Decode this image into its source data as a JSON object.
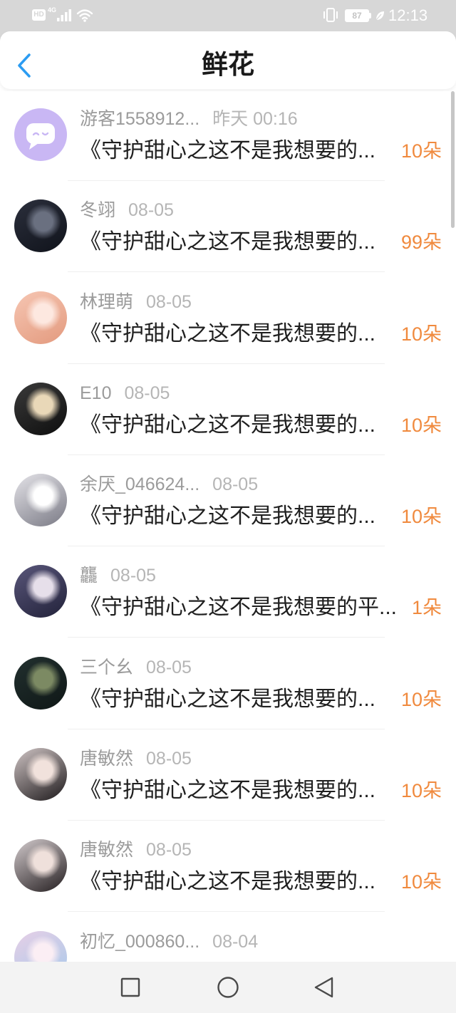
{
  "status_bar": {
    "hd_label": "HD",
    "network_label": "4G",
    "battery_level": "87",
    "time": "12:13",
    "icons": [
      "signal-icon",
      "wifi-icon",
      "vibrate-icon",
      "battery-icon",
      "eco-leaf-icon"
    ]
  },
  "header": {
    "back_icon": "chevron-left-icon",
    "title": "鲜花"
  },
  "flower_records": [
    {
      "user": "游客1558912...",
      "time": "昨天 00:16",
      "book": "《守护甜心之这不是我想要的...",
      "amount": "10朵",
      "avatar": {
        "icon": "chat-bubble-icon",
        "colors": [
          "#c9b7f4"
        ]
      }
    },
    {
      "user": "冬翊",
      "time": "08-05",
      "book": "《守护甜心之这不是我想要的...",
      "amount": "99朵",
      "avatar": {
        "colors": [
          "#6a7080",
          "#2b2f3c",
          "#10131b"
        ]
      }
    },
    {
      "user": "林理萌",
      "time": "08-05",
      "book": "《守护甜心之这不是我想要的...",
      "amount": "10朵",
      "avatar": {
        "colors": [
          "#fde8e0",
          "#f6c6b3",
          "#e39a7e"
        ]
      }
    },
    {
      "user": "E10",
      "time": "08-05",
      "book": "《守护甜心之这不是我想要的...",
      "amount": "10朵",
      "avatar": {
        "colors": [
          "#e9d8b8",
          "#3a3a3a",
          "#0e0e0e"
        ]
      }
    },
    {
      "user": "余厌_046624...",
      "time": "08-05",
      "book": "《守护甜心之这不是我想要的...",
      "amount": "10朵",
      "avatar": {
        "colors": [
          "#ffffff",
          "#e4e3e8",
          "#7a7a85"
        ]
      }
    },
    {
      "user": "龘",
      "time": "08-05",
      "book": "《守护甜心之这不是我想要的平...",
      "amount": "1朵",
      "avatar": {
        "colors": [
          "#e6dfea",
          "#59567a",
          "#22223a"
        ]
      }
    },
    {
      "user": "三个幺",
      "time": "08-05",
      "book": "《守护甜心之这不是我想要的...",
      "amount": "10朵",
      "avatar": {
        "colors": [
          "#7c8a63",
          "#22302f",
          "#0f1716"
        ]
      }
    },
    {
      "user": "唐敏然",
      "time": "08-05",
      "book": "《守护甜心之这不是我想要的...",
      "amount": "10朵",
      "avatar": {
        "colors": [
          "#f1e2dc",
          "#cfc4c4",
          "#1e1a1c"
        ]
      }
    },
    {
      "user": "唐敏然",
      "time": "08-05",
      "book": "《守护甜心之这不是我想要的...",
      "amount": "10朵",
      "avatar": {
        "colors": [
          "#efe0db",
          "#d3cbcd",
          "#241e20"
        ]
      }
    },
    {
      "user": "初忆_000860...",
      "time": "08-04",
      "avatar": {
        "colors": [
          "#fbeef4",
          "#e7cfe6",
          "#a6c9ea"
        ]
      }
    }
  ],
  "navigation_bar": {
    "icons": [
      "recent-apps-icon",
      "home-icon",
      "back-triangle-icon"
    ]
  },
  "colors": {
    "status_bar_bg": "#d7d7d7",
    "accent": "#2b9cf2",
    "amount": "#f08a3e",
    "username": "#9b9b9b",
    "time": "#b5b5b5",
    "book_title": "#1f1f1f",
    "nav_bar_bg": "#f3f3f3"
  }
}
